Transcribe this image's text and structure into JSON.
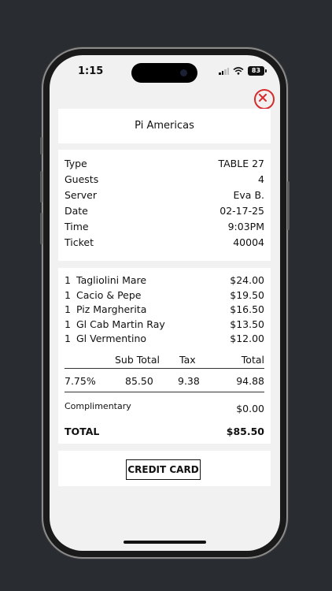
{
  "status_bar": {
    "time": "1:15",
    "battery": "83"
  },
  "restaurant": {
    "name": "Pi Americas"
  },
  "info": [
    {
      "label": "Type",
      "value": "TABLE 27"
    },
    {
      "label": "Guests",
      "value": "4"
    },
    {
      "label": "Server",
      "value": "Eva B."
    },
    {
      "label": "Date",
      "value": "02-17-25"
    },
    {
      "label": "Time",
      "value": "9:03PM"
    },
    {
      "label": "Ticket",
      "value": "40004"
    }
  ],
  "items": [
    {
      "qty": "1",
      "name": "Tagliolini Mare",
      "price": "$24.00"
    },
    {
      "qty": "1",
      "name": "Cacio & Pepe",
      "price": "$19.50"
    },
    {
      "qty": "1",
      "name": "Piz Margherita",
      "price": "$16.50"
    },
    {
      "qty": "1",
      "name": "Gl Cab Martin Ray",
      "price": "$13.50"
    },
    {
      "qty": "1",
      "name": "Gl Vermentino",
      "price": "$12.00"
    }
  ],
  "tax_table": {
    "headers": {
      "subtotal": "Sub Total",
      "tax": "Tax",
      "total": "Total"
    },
    "values": {
      "rate": "7.75%",
      "subtotal": "85.50",
      "tax": "9.38",
      "total": "94.88"
    }
  },
  "complimentary": {
    "label": "Complimentary",
    "value": "$0.00"
  },
  "grand_total": {
    "label": "TOTAL",
    "value": "$85.50"
  },
  "payment": {
    "button_label": "CREDIT CARD"
  },
  "colors": {
    "close_accent": "#d72b2b",
    "background": "#292c31",
    "screen": "#f1f1f1"
  }
}
